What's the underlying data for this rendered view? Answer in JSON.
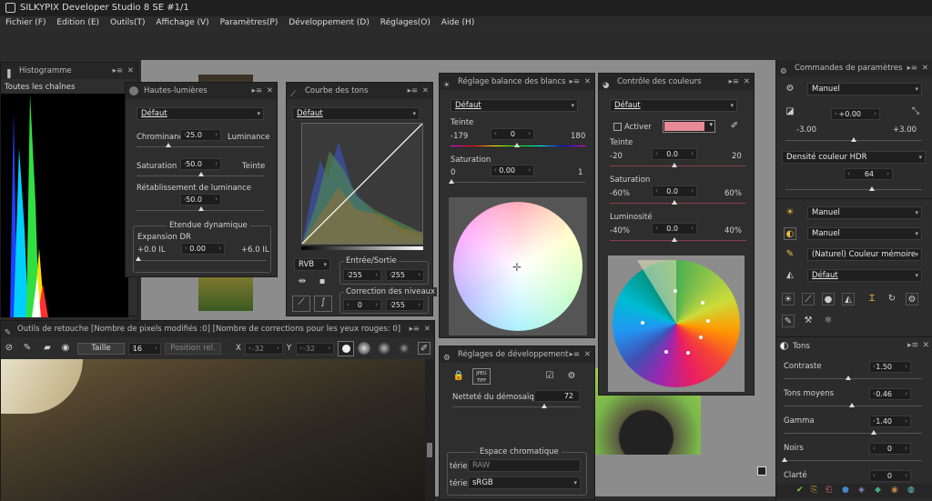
{
  "window": {
    "title": "SILKYPIX Developer Studio 8 SE   #1/1"
  },
  "menu": [
    "Fichier (F)",
    "Edition (E)",
    "Outils(T)",
    "Affichage (V)",
    "Paramètres(P)",
    "Développement (D)",
    "Réglages(O)",
    "Aide (H)"
  ],
  "histogram": {
    "title": "Histogramme",
    "channel": "Toutes les chaînes"
  },
  "highlights": {
    "title": "Hautes-lumières",
    "preset": "Défaut",
    "chrom_label": "Chrominance",
    "lum_label": "Luminance",
    "chrom_value": "25.0",
    "sat_label": "Saturation",
    "teinte_label": "Teinte",
    "sat_value": "50.0",
    "restore_label": "Rétablissement de luminance",
    "restore_value": "50.0",
    "dr_title": "Etendue dynamique",
    "dr_label": "Expansion DR",
    "dr_min": "+0.0 IL",
    "dr_value": "0.00",
    "dr_max": "+6.0 IL"
  },
  "curve": {
    "title": "Courbe des tons",
    "preset": "Défaut",
    "channel": "RVB",
    "io_title": "Entrée/Sortie",
    "io_in": "255",
    "io_out": "255",
    "levels_title": "Correction des niveaux",
    "lev_lo": "0",
    "lev_hi": "255"
  },
  "wb": {
    "title": "Réglage balance des blancs",
    "preset": "Défaut",
    "tint_label": "Teinte",
    "tint_min": "-179",
    "tint_value": "0",
    "tint_max": "180",
    "sat_label": "Saturation",
    "sat_min": "0",
    "sat_value": "0.00",
    "sat_max": "1"
  },
  "color": {
    "title": "Contrôle des couleurs",
    "preset": "Défaut",
    "activate_label": "Activer",
    "teinte_label": "Teinte",
    "t_min": "-20",
    "t_value": "0.0",
    "t_max": "20",
    "sat_label": "Saturation",
    "s_min": "-60%",
    "s_value": "0.0",
    "s_max": "60%",
    "lum_label": "Luminosité",
    "l_min": "-40%",
    "l_value": "0.0",
    "l_max": "40%"
  },
  "retouch": {
    "title": "Outils de retouche [Nombre de pixels modifiés :0] [Nombre de corrections pour les yeux rouges: 0]",
    "size_label": "Taille",
    "size_value": "16",
    "pos_label": "Position rel.",
    "x_label": "X",
    "x_value": "-32",
    "y_label": "Y",
    "y_value": "-32"
  },
  "dev": {
    "title": "Réglages de développement",
    "file_type": "JPEG TIFF",
    "sharp_label": "Netteté du démosaïquage",
    "sharp_value": "72",
    "space_title": "Espace chromatique",
    "row1_label": "térieu",
    "row1_value": "RAW",
    "row2_label": "térieu",
    "row2_value": "sRGB"
  },
  "params": {
    "title": "Commandes de paramètres",
    "exposure_mode": "Manuel",
    "exp_value": "+0.00",
    "exp_min": "-3.00",
    "exp_max": "+3.00",
    "hdr_label": "Densité couleur HDR",
    "hdr_value": "64",
    "wb_mode": "Manuel",
    "tone_mode": "Manuel",
    "color_mode": "(Naturel) Couleur mémoire",
    "sharp_preset": "Défaut"
  },
  "tones": {
    "title": "Tons",
    "items": [
      {
        "label": "Contraste",
        "value": "1.50"
      },
      {
        "label": "Tons moyens",
        "value": "0.46"
      },
      {
        "label": "Gamma",
        "value": "1.40"
      },
      {
        "label": "Noirs",
        "value": "0"
      },
      {
        "label": "Clarté",
        "value": "0"
      }
    ]
  },
  "colors": {
    "accent": "#e88a98",
    "bg": "#2b2b2b",
    "panel": "#2e2e2e"
  }
}
